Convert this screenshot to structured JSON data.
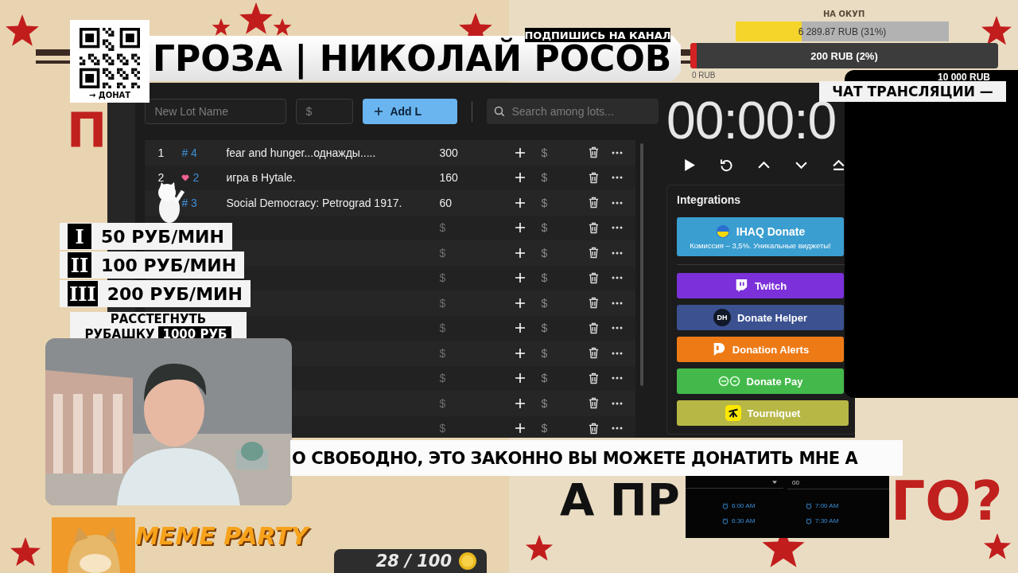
{
  "poster": {
    "kind": "picture",
    "letter": "П",
    "slogan_left": "А ПР",
    "slogan_right": "ГО?"
  },
  "title_banner": {
    "title": "ГРОЗА | НИКОЛАЙ РОСОВ",
    "subscribe": "ПОДПИШИСЬ НА КАНАЛ"
  },
  "qr": {
    "caption": "→ ДОНАТ"
  },
  "goal": {
    "label": "НА ОКУП",
    "bars": [
      {
        "kind": "total",
        "text": "6 289.87 RUB (31%)",
        "level": 0.31
      },
      {
        "kind": "current",
        "text": "200 RUB (2%)",
        "level": 0.02
      }
    ],
    "min": "0 RUB",
    "max": "10 000 RUB"
  },
  "app": {
    "new_lot": {
      "placeholder": "New Lot Name"
    },
    "amount": {
      "placeholder": "$"
    },
    "add_button": "Add L",
    "search": {
      "placeholder": "Search among lots..."
    },
    "lots": [
      {
        "number": "1",
        "kind": "hash",
        "tag": "# 4",
        "name": "fear and hunger...однажды.....",
        "amount": "300",
        "symbol": "$"
      },
      {
        "number": "2",
        "kind": "heart",
        "tag": "2",
        "name": "игра в Hytale.",
        "amount": "160",
        "symbol": "$"
      },
      {
        "kind": "hash",
        "tag": "# 3",
        "name": "Social Democracy: Petrograd 1917.",
        "amount": "60",
        "symbol": "$"
      },
      {
        "amount_placeholder": "$",
        "symbol": "$"
      },
      {
        "amount_placeholder": "$",
        "symbol": "$"
      },
      {
        "amount_placeholder": "$",
        "symbol": "$"
      },
      {
        "amount_placeholder": "$",
        "symbol": "$"
      },
      {
        "amount_placeholder": "$",
        "symbol": "$"
      },
      {
        "amount_placeholder": "$",
        "symbol": "$"
      },
      {
        "amount_placeholder": "$",
        "symbol": "$"
      },
      {
        "amount_placeholder": "$",
        "symbol": "$"
      },
      {
        "amount_placeholder": "$",
        "symbol": "$"
      }
    ],
    "timer": "00:00:0",
    "integrations": {
      "title": "Integrations",
      "items": [
        {
          "kind": "ihaq",
          "label": "IHAQ Donate",
          "subtitle": "Комиссия – 3,5%. Уникальные виджеты!",
          "color": "#3a9ed0"
        },
        {
          "kind": "twitch",
          "label": "Twitch",
          "color": "#7b30d9"
        },
        {
          "kind": "helper",
          "label": "Donate Helper",
          "badge": "DH",
          "color": "#3b5190"
        },
        {
          "kind": "alerts",
          "label": "Donation Alerts",
          "color": "#ee7a16"
        },
        {
          "kind": "pay",
          "label": "Donate Pay",
          "color": "#44b94b"
        },
        {
          "kind": "tourniquet",
          "label": "Tourniquet",
          "color": "#b7b746"
        }
      ]
    }
  },
  "chat": {
    "title": "ЧАТ ТРАНСЛЯЦИИ —"
  },
  "price_list": {
    "tiers": [
      {
        "numeral": "I",
        "text": "50 РУБ/МИН"
      },
      {
        "numeral": "II",
        "text": "100 РУБ/МИН"
      },
      {
        "numeral": "III",
        "text": "200 РУБ/МИН"
      }
    ],
    "extra_line1": "РАССТЕГНУТЬ",
    "extra_line2": "РУБАШКУ",
    "extra_price": "1000 РУБ"
  },
  "meme_party": {
    "title": "MEME PARTY",
    "count": "28 / 100"
  },
  "subtitle": "О СВОБОДНО, ЭТО ЗАКОННО ВЫ МОЖЕТЕ ДОНАТИТЬ МНЕ А",
  "time_picker": {
    "hour": "00",
    "times": [
      "6:00 AM",
      "7:00 AM",
      "6:30 AM",
      "7:30 AM"
    ]
  }
}
